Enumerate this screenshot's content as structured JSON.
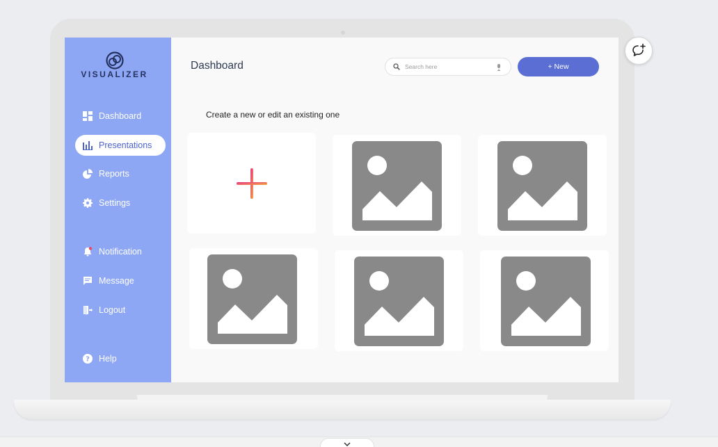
{
  "brand": {
    "name": "VISUALIZER",
    "logo_icon": "interlocking-rings-logo"
  },
  "sidebar": {
    "items": [
      {
        "label": "Dashboard",
        "icon": "dashboard-grid-icon",
        "active": false
      },
      {
        "label": "Presentations",
        "icon": "bar-chart-icon",
        "active": true
      },
      {
        "label": "Reports",
        "icon": "pie-chart-icon",
        "active": false
      },
      {
        "label": "Settings",
        "icon": "gear-icon",
        "active": false
      },
      {
        "label": "Notification",
        "icon": "bell-icon",
        "active": false
      },
      {
        "label": "Message",
        "icon": "message-icon",
        "active": false
      },
      {
        "label": "Logout",
        "icon": "logout-icon",
        "active": false
      },
      {
        "label": "Help",
        "icon": "help-icon",
        "active": false
      }
    ]
  },
  "header": {
    "title": "Dashboard",
    "search_placeholder": "Search here",
    "new_button_label": "+ New"
  },
  "main": {
    "heading": "Create a new or edit an existing one",
    "cards": [
      {
        "type": "add",
        "icon": "plus-icon"
      },
      {
        "type": "image",
        "icon": "image-placeholder-icon"
      },
      {
        "type": "image",
        "icon": "image-placeholder-icon"
      },
      {
        "type": "image",
        "icon": "image-placeholder-icon"
      },
      {
        "type": "image",
        "icon": "image-placeholder-icon"
      },
      {
        "type": "image",
        "icon": "image-placeholder-icon"
      }
    ]
  },
  "colors": {
    "sidebar_bg": "#8ea7f5",
    "accent": "#5b6ed3",
    "brand_text": "#25325f",
    "placeholder_gray": "#898989"
  }
}
